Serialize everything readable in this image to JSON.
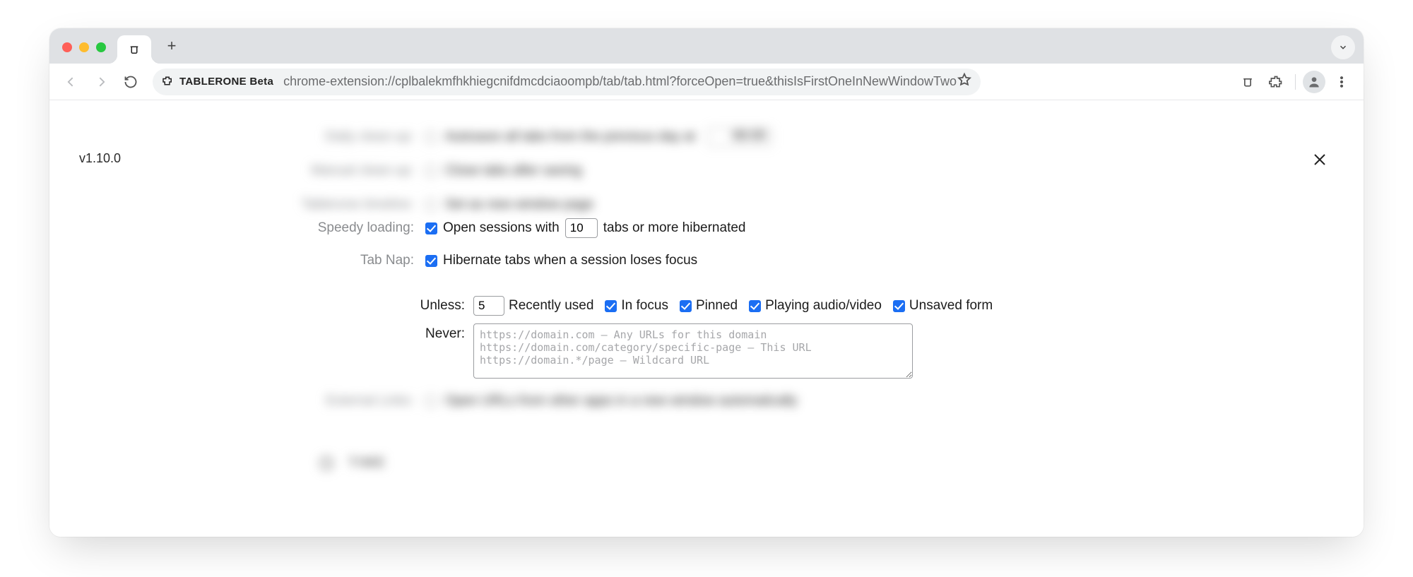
{
  "omnibox": {
    "badge": "TABLERONE Beta",
    "url": "chrome-extension://cplbalekmfhkhiegcnifdmcdciaoompb/tab/tab.html?forceOpen=true&thisIsFirstOneInNewWindowTwo"
  },
  "page": {
    "version": "v1.10.0"
  },
  "blurred": {
    "daily_label": "Daily clean-up:",
    "daily_text": "Autosave all tabs from the previous day at",
    "daily_time": "06:00",
    "manual_label": "Manual clean-up:",
    "manual_text": "Close tabs after saving",
    "timeline_label": "Tablerone timeline:",
    "timeline_text": "Set as new window page",
    "external_label": "External Links:",
    "external_text": "Open URLs from other apps in a new window automatically",
    "time_header": "TIME"
  },
  "settings": {
    "speedy": {
      "label": "Speedy loading:",
      "pre": "Open sessions with",
      "value": "10",
      "post": "tabs or more hibernated"
    },
    "tabnap": {
      "label": "Tab Nap:",
      "text": "Hibernate tabs when a session loses focus"
    },
    "unless": {
      "label": "Unless:",
      "recent_value": "5",
      "recent_label": "Recently used",
      "focus_label": "In focus",
      "pinned_label": "Pinned",
      "audio_label": "Playing audio/video",
      "form_label": "Unsaved form"
    },
    "never": {
      "label": "Never:",
      "placeholder": "https://domain.com – Any URLs for this domain\nhttps://domain.com/category/specific-page – This URL\nhttps://domain.*/page – Wildcard URL"
    }
  }
}
